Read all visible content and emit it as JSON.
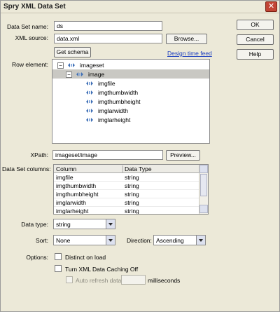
{
  "window": {
    "title": "Spry XML Data Set"
  },
  "buttons": {
    "ok": "OK",
    "cancel": "Cancel",
    "help": "Help",
    "browse": "Browse...",
    "get_schema": "Get schema",
    "preview": "Preview..."
  },
  "form": {
    "dataset_name_label": "Data Set name:",
    "dataset_name_value": "ds",
    "xml_source_label": "XML source:",
    "xml_source_value": "data.xml",
    "design_time_feed": "Design time feed",
    "row_element_label": "Row element:",
    "xpath_label": "XPath:",
    "xpath_value": "imageset/image",
    "columns_label": "Data Set columns:",
    "data_type_label": "Data type:",
    "data_type_value": "string",
    "sort_label": "Sort:",
    "sort_value": "None",
    "direction_label": "Direction:",
    "direction_value": "Ascending",
    "options_label": "Options:",
    "distinct_label": "Distinct on load",
    "caching_label": "Turn XML Data Caching Off",
    "auto_refresh_label": "Auto refresh data",
    "milliseconds_label": "milliseconds"
  },
  "tree": {
    "root": "imageset",
    "selected": "image",
    "children": [
      "imgfile",
      "imgthumbwidth",
      "imgthumbheight",
      "imglarwidth",
      "imglarheight"
    ]
  },
  "columns_table": {
    "headers": [
      "Column",
      "Data Type"
    ],
    "rows": [
      [
        "imgfile",
        "string"
      ],
      [
        "imgthumbwidth",
        "string"
      ],
      [
        "imgthumbheight",
        "string"
      ],
      [
        "imglarwidth",
        "string"
      ],
      [
        "imglarheight",
        "string"
      ]
    ]
  },
  "icons": {
    "close": "close-icon",
    "node": "xml-node-icon",
    "collapse": "collapse-icon",
    "dropdown": "chevron-down-icon"
  },
  "colors": {
    "link": "#1c3fc0",
    "selection": "#c9c8c3",
    "close_button": "#c24535"
  }
}
